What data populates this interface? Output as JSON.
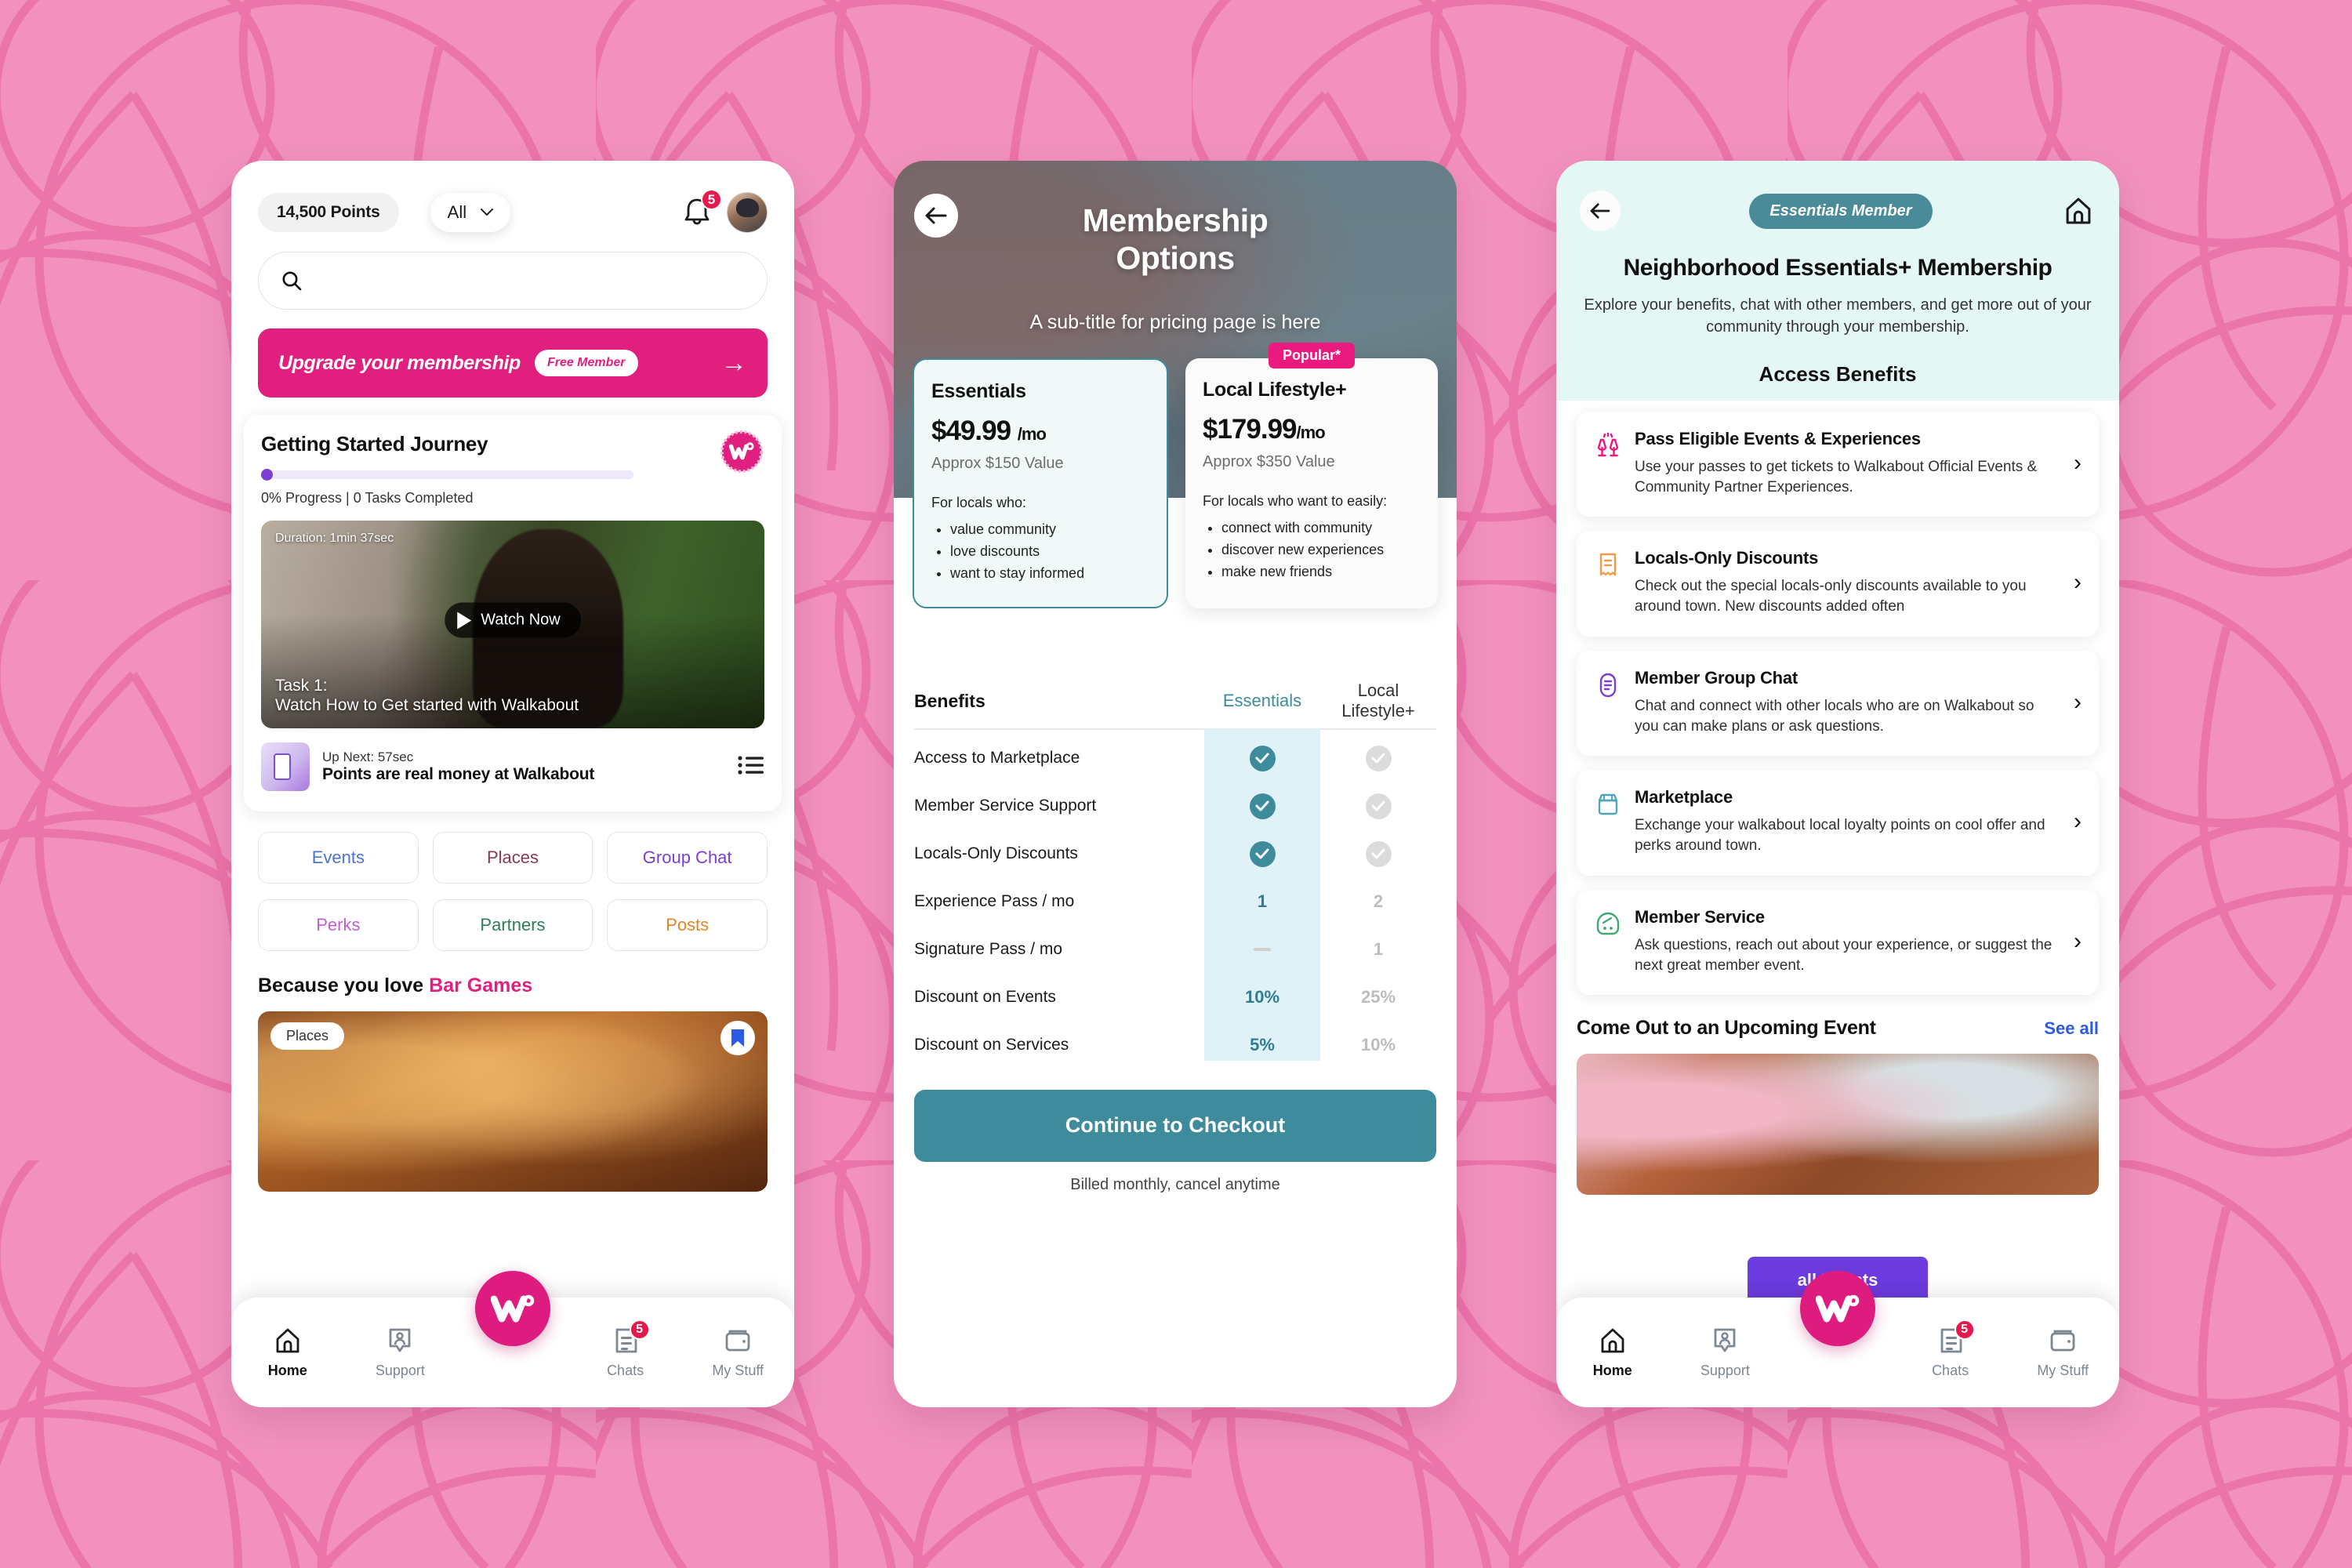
{
  "background": {
    "base_color": "#F291BE",
    "line_color": "#EA6FA8"
  },
  "brand": {
    "pink": "#E01F7E",
    "teal": "#3E8B9C",
    "mint": "#E4F7F4"
  },
  "phone1": {
    "points_pill": "14,500 Points",
    "filter_select": {
      "value": "All",
      "icon": "chevron-down-icon"
    },
    "notification_badge": "5",
    "search_placeholder": "",
    "upgrade_banner": {
      "text": "Upgrade your membership",
      "tag": "Free Member",
      "arrow": "→"
    },
    "journey": {
      "title": "Getting Started Journey",
      "progress_label": "0% Progress | 0 Tasks Completed",
      "progress_percent": 0,
      "video": {
        "duration": "Duration: 1min 37sec",
        "watch_label": "Watch Now",
        "task_line1": "Task  1:",
        "task_line2": "Watch How to Get started with Walkabout"
      },
      "up_next": {
        "label": "Up Next:  57sec",
        "title": "Points are real money at Walkabout"
      }
    },
    "chips": [
      {
        "label": "Events",
        "color": "#4B73D6"
      },
      {
        "label": "Places",
        "color": "#8B3A55"
      },
      {
        "label": "Group Chat",
        "color": "#7B3FD4"
      },
      {
        "label": "Perks",
        "color": "#C25FD0"
      },
      {
        "label": "Partners",
        "color": "#2F7D58"
      },
      {
        "label": "Posts",
        "color": "#E58524"
      }
    ],
    "because_prefix": "Because you love ",
    "because_accent": "Bar Games",
    "bar_card": {
      "tag": "Places",
      "bookmark_icon": "bookmark-icon"
    },
    "nav": [
      {
        "label": "Home",
        "icon": "home-icon",
        "active": true,
        "badge": ""
      },
      {
        "label": "Support",
        "icon": "support-icon",
        "active": false,
        "badge": ""
      },
      {
        "label": "Chats",
        "icon": "chats-icon",
        "active": false,
        "badge": "5"
      },
      {
        "label": "My Stuff",
        "icon": "wallet-icon",
        "active": false,
        "badge": ""
      }
    ]
  },
  "phone2": {
    "back_icon": "back-arrow-icon",
    "title": "Membership\nOptions",
    "title_line1": "Membership",
    "title_line2": "Options",
    "subtitle": "A sub-title for pricing page is here",
    "plans": [
      {
        "name": "Essentials",
        "price": "$49.99",
        "period": "/mo",
        "value": "Approx $150 Value",
        "for_label": "For locals who:",
        "bullets": [
          "value community",
          "love discounts",
          "want to stay informed"
        ],
        "popular": false,
        "selected": true
      },
      {
        "name": "Local Lifestyle+",
        "price": "$179.99",
        "period": "/mo",
        "value": "Approx $350 Value",
        "for_label": "For locals who want to easily:",
        "bullets": [
          "connect with community",
          "discover new experiences",
          "make new friends"
        ],
        "popular": true,
        "popular_tag": "Popular*",
        "selected": false
      }
    ],
    "benefits_table": {
      "col_benefit": "Benefits",
      "col_essentials": "Essentials",
      "col_lifestyle": "Local Lifestyle+",
      "rows": [
        {
          "name": "Access to Marketplace",
          "essentials": "check",
          "lifestyle": "check-muted"
        },
        {
          "name": "Member Service Support",
          "essentials": "check",
          "lifestyle": "check-muted"
        },
        {
          "name": "Locals-Only Discounts",
          "essentials": "check",
          "lifestyle": "check-muted"
        },
        {
          "name": "Experience Pass / mo",
          "essentials": "1",
          "lifestyle": "2"
        },
        {
          "name": "Signature Pass / mo",
          "essentials": "dash",
          "lifestyle": "1"
        },
        {
          "name": "Discount on Events",
          "essentials": "10%",
          "lifestyle": "25%"
        },
        {
          "name": "Discount on Services",
          "essentials": "5%",
          "lifestyle": "10%"
        }
      ]
    },
    "checkout_button": "Continue to Checkout",
    "billing_note": "Billed monthly, cancel anytime"
  },
  "phone3": {
    "back_icon": "back-arrow-icon",
    "member_pill": "Essentials Member",
    "home_icon": "home-icon",
    "title": "Neighborhood Essentials+ Membership",
    "subtitle": "Explore your benefits, chat with other members, and get more out of your community through your membership.",
    "section_title": "Access Benefits",
    "benefits": [
      {
        "icon": "cheers-icon",
        "icon_color": "#E8197F",
        "title": "Pass Eligible Events & Experiences",
        "desc": "Use your passes to get tickets to Walkabout Official Events & Community Partner Experiences."
      },
      {
        "icon": "ticket-icon",
        "icon_color": "#F39A4A",
        "title": "Locals-Only Discounts",
        "desc": "Check out the special locals-only discounts available to you around town. New discounts added often"
      },
      {
        "icon": "group-chat-icon",
        "icon_color": "#7B3FD4",
        "title": "Member Group Chat",
        "desc": "Chat and connect with other locals who are on Walkabout so you can make plans or ask questions."
      },
      {
        "icon": "marketplace-icon",
        "icon_color": "#4FA6B8",
        "title": "Marketplace",
        "desc": "Exchange your walkabout local loyalty points on cool offer and perks around town."
      },
      {
        "icon": "member-service-icon",
        "icon_color": "#3FA873",
        "title": "Member Service",
        "desc": "Ask questions, reach out about your experience, or suggest the next great member event."
      }
    ],
    "events": {
      "title": "Come Out to an Upcoming Event",
      "see_all": "See all",
      "overlay_label": "all Events"
    },
    "nav": [
      {
        "label": "Home",
        "icon": "home-icon",
        "active": true,
        "badge": ""
      },
      {
        "label": "Support",
        "icon": "support-icon",
        "active": false,
        "badge": ""
      },
      {
        "label": "Chats",
        "icon": "chats-icon",
        "active": false,
        "badge": "5"
      },
      {
        "label": "My Stuff",
        "icon": "wallet-icon",
        "active": false,
        "badge": ""
      }
    ]
  }
}
